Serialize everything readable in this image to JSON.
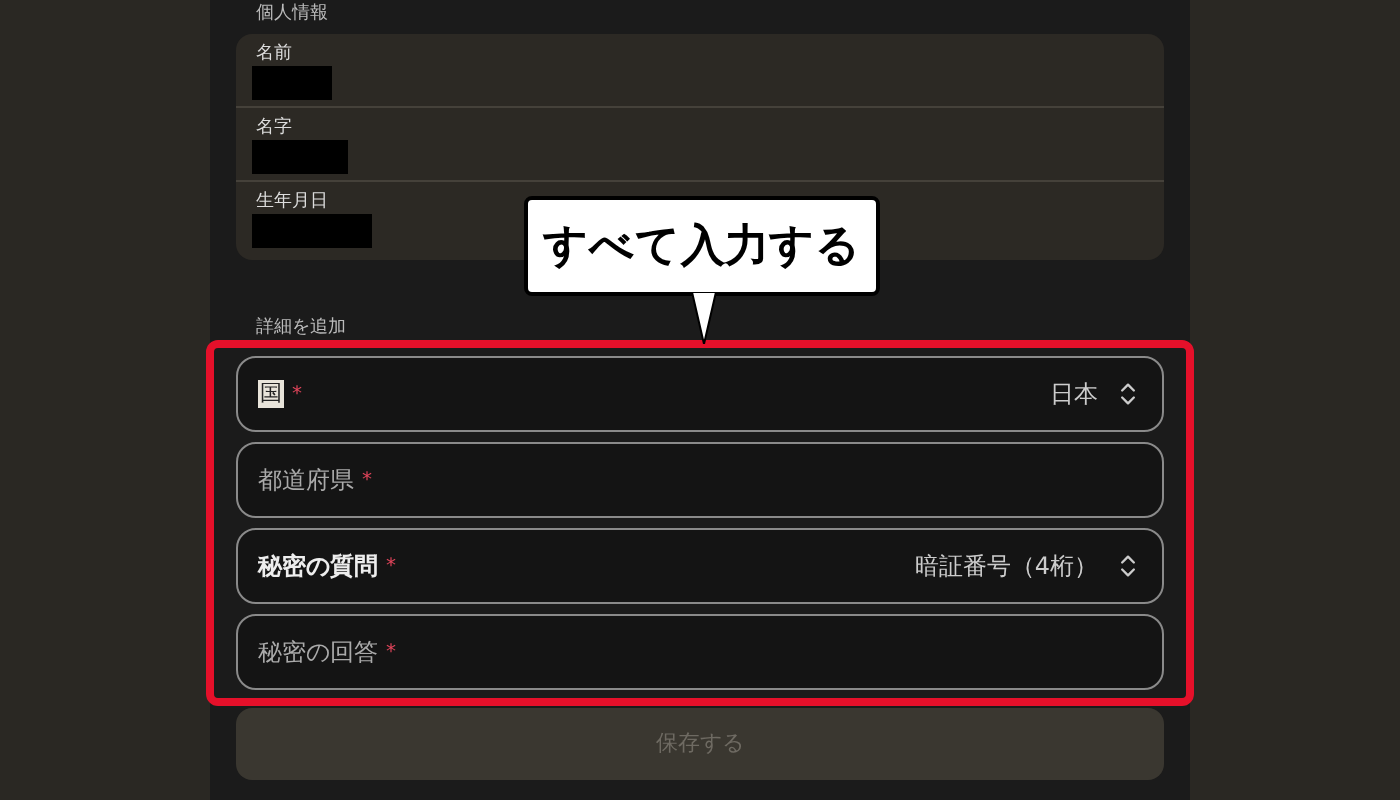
{
  "personal_info": {
    "heading": "個人情報",
    "rows": [
      {
        "label": "名前",
        "redacted": true
      },
      {
        "label": "名字",
        "redacted": true
      },
      {
        "label": "生年月日",
        "redacted": true
      }
    ]
  },
  "details": {
    "heading": "詳細を追加",
    "fields": [
      {
        "kind": "select",
        "label": "国",
        "required_mark": "*",
        "value": "日本"
      },
      {
        "kind": "text",
        "placeholder": "都道府県",
        "required_mark": "*"
      },
      {
        "kind": "select",
        "label": "秘密の質問",
        "required_mark": "*",
        "value": "暗証番号（4桁）"
      },
      {
        "kind": "text",
        "placeholder": "秘密の回答",
        "required_mark": "*"
      }
    ]
  },
  "save_button": {
    "label": "保存する",
    "disabled": true
  },
  "annotation": {
    "callout": "すべて入力する"
  }
}
